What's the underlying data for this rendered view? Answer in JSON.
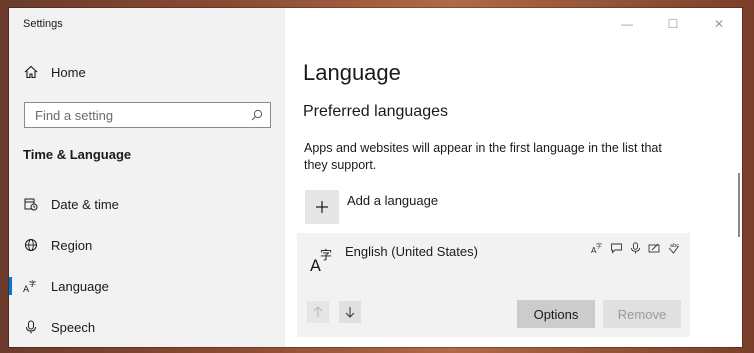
{
  "window": {
    "title": "Settings",
    "controls": {
      "minimize": "—",
      "maximize": "☐",
      "close": "✕"
    }
  },
  "sidebar": {
    "home_label": "Home",
    "search_placeholder": "Find a setting",
    "section_heading": "Time & Language",
    "items": [
      {
        "label": "Date & time",
        "icon": "calendar-clock-icon"
      },
      {
        "label": "Region",
        "icon": "globe-icon"
      },
      {
        "label": "Language",
        "icon": "language-icon",
        "selected": true
      },
      {
        "label": "Speech",
        "icon": "microphone-icon"
      }
    ]
  },
  "main": {
    "title": "Language",
    "subtitle": "Preferred languages",
    "description": "Apps and websites will appear in the first language in the list that they support.",
    "add_language_label": "Add a language",
    "language_card": {
      "name": "English (United States)",
      "options_label": "Options",
      "remove_label": "Remove"
    }
  },
  "colors": {
    "sidebar_bg": "#f2f2f2",
    "accent": "#0078d7",
    "card_bg": "#f2f2f2",
    "button_bg": "#cccccc"
  }
}
